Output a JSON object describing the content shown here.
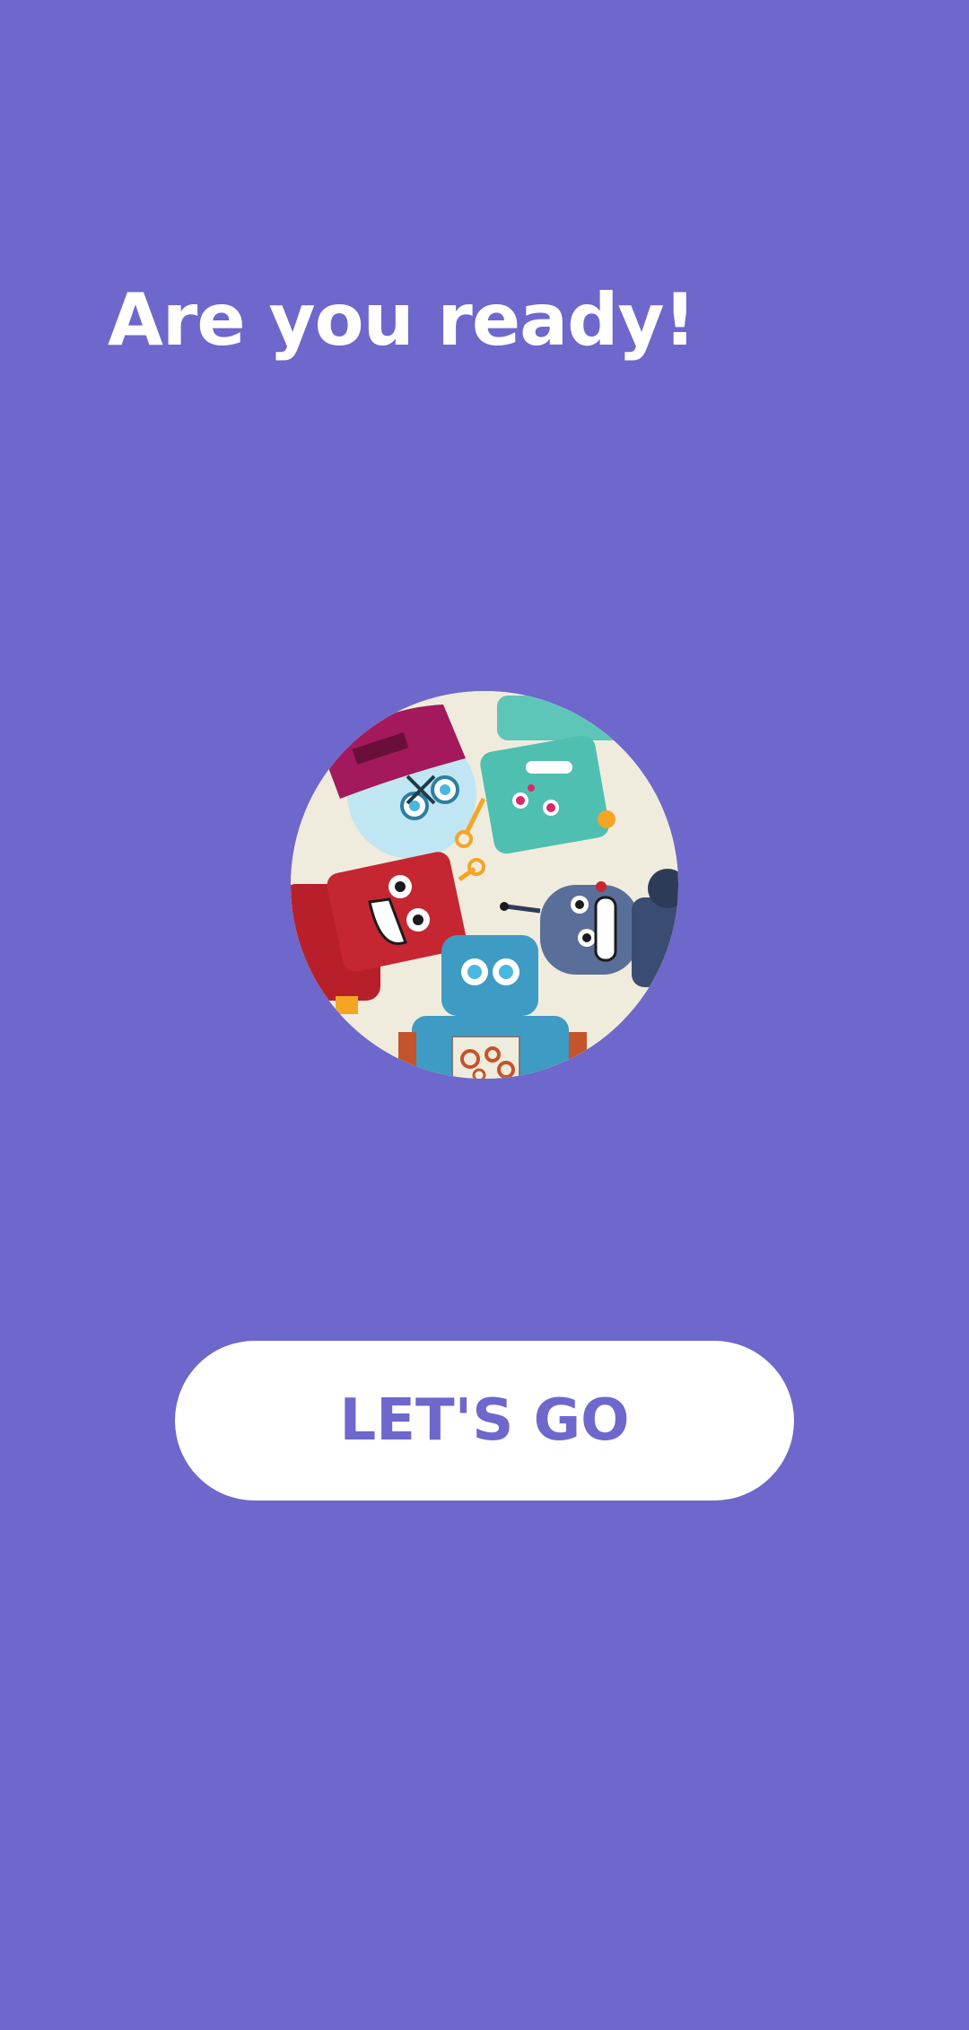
{
  "screen": {
    "title": "Are you ready!",
    "illustration_icon": "robots-illustration",
    "primary_button_label": "LET'S GO"
  },
  "colors": {
    "background": "#6e67cc",
    "button_bg": "#ffffff",
    "button_text": "#6e67cc",
    "title_text": "#ffffff"
  }
}
